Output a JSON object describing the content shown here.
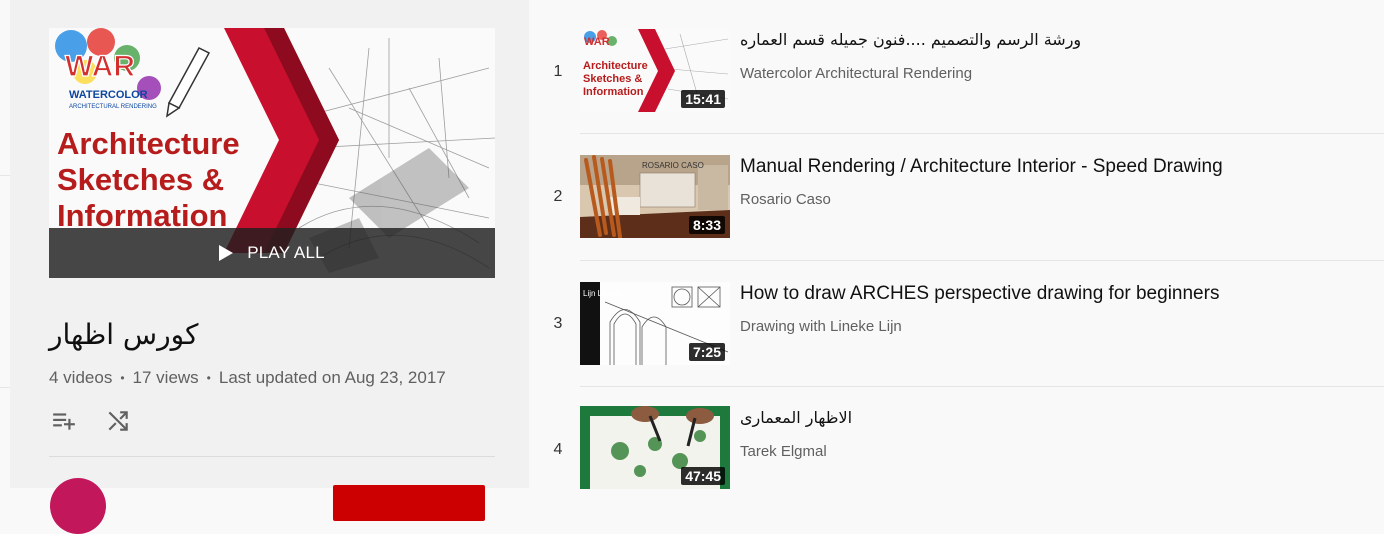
{
  "playlist": {
    "hero_lines": [
      "Architecture",
      "Sketches &",
      "Information"
    ],
    "logo_text": "WAR",
    "logo_sub": [
      "WATERCOLOR",
      "ARCHITECTURAL RENDERING"
    ],
    "play_all": "PLAY ALL",
    "title": "كورس اظهار",
    "videos": "4 videos",
    "views": "17 views",
    "updated": "Last updated on Aug 23, 2017",
    "actions": [
      {
        "name": "add-to-queue-icon"
      },
      {
        "name": "shuffle-icon"
      }
    ]
  },
  "videos": [
    {
      "index": "1",
      "title": "ورشة الرسم والتصميم ....فنون جميله قسم العماره",
      "channel": "Watercolor Architectural Rendering",
      "duration": "15:41",
      "thumb_lines": [
        "Architecture",
        "Sketches &",
        "Information"
      ]
    },
    {
      "index": "2",
      "title": "Manual Rendering / Architecture Interior - Speed Drawing",
      "channel": "Rosario Caso",
      "duration": "8:33",
      "thumb_caption": "ROSARIO CASO"
    },
    {
      "index": "3",
      "title": "How to draw ARCHES perspective drawing for beginners",
      "channel": "Drawing with Lineke Lijn",
      "duration": "7:25",
      "thumb_caption": "Lijn Lineke"
    },
    {
      "index": "4",
      "title": "الاظهار المعمارى",
      "channel": "Tarek Elgmal",
      "duration": "47:45"
    }
  ],
  "colors": {
    "accent_red": "#cc0000",
    "text_secondary": "#606060",
    "sidebar_bg": "#f1f1f1"
  }
}
